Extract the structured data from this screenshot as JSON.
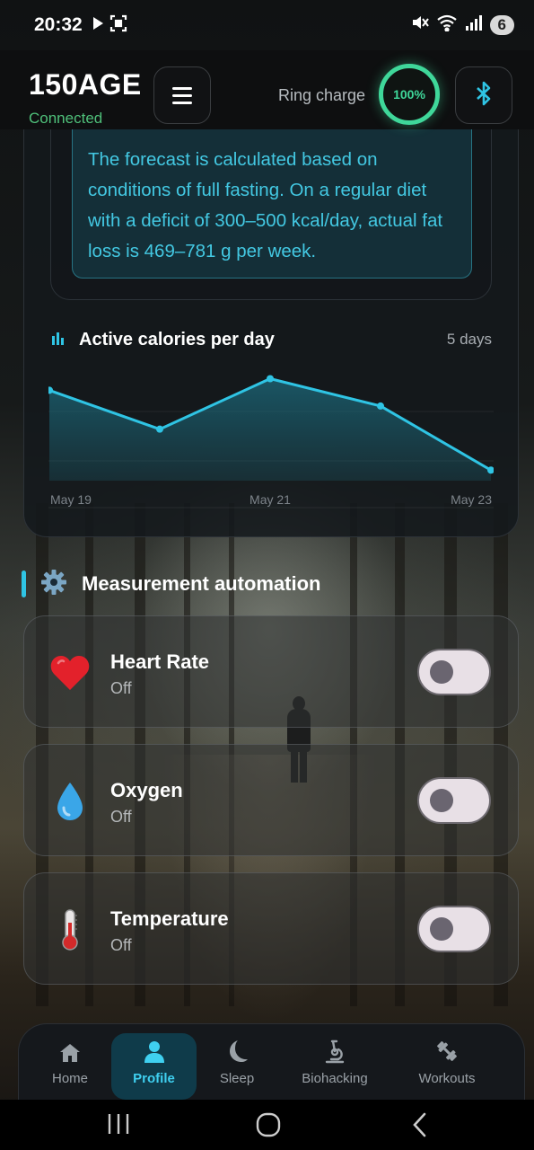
{
  "status_bar": {
    "time": "20:32",
    "notification_count": "6",
    "icons": [
      "play-icon",
      "screenshot-icon",
      "mute-icon",
      "wifi-icon",
      "signal-icon"
    ]
  },
  "header": {
    "app_title": "150AGE",
    "connection_status": "Connected",
    "ring_charge_label": "Ring charge",
    "ring_charge_value": "100%",
    "ring_charge_fraction": 1.0,
    "colors": {
      "connected": "#4fc07a",
      "charge": "#3fd79a",
      "bluetooth": "#2fc4e4"
    }
  },
  "forecast": {
    "text": "The forecast is calculated based on conditions of full fasting. On a regular diet with a deficit of 300–500 kcal/day, actual fat loss is 469–781 g per week."
  },
  "calories_chart": {
    "title": "Active calories per day",
    "range_label": "5 days"
  },
  "chart_data": {
    "type": "area",
    "title": "Active calories per day",
    "x": [
      "May 19",
      "May 20",
      "May 21",
      "May 22",
      "May 23"
    ],
    "tick_labels": [
      "May 19",
      "May 21",
      "May 23"
    ],
    "series": [
      {
        "values": [
          0.86,
          0.49,
          0.97,
          0.71,
          0.1
        ]
      }
    ],
    "ylim": [
      0,
      1
    ],
    "grid": true,
    "line_color": "#2fc4e4",
    "fill_color": "#1c6a7c"
  },
  "automation": {
    "title": "Measurement automation",
    "items": [
      {
        "name": "Heart Rate",
        "status": "Off",
        "icon": "heart-icon",
        "enabled": false
      },
      {
        "name": "Oxygen",
        "status": "Off",
        "icon": "droplet-icon",
        "enabled": false
      },
      {
        "name": "Temperature",
        "status": "Off",
        "icon": "thermometer-icon",
        "enabled": false
      }
    ]
  },
  "bottom_nav": {
    "items": [
      {
        "label": "Home",
        "icon": "home-icon",
        "active": false
      },
      {
        "label": "Profile",
        "icon": "profile-icon",
        "active": true
      },
      {
        "label": "Sleep",
        "icon": "moon-icon",
        "active": false
      },
      {
        "label": "Biohacking",
        "icon": "microscope-icon",
        "active": false
      },
      {
        "label": "Workouts",
        "icon": "dumbbell-icon",
        "active": false
      }
    ]
  }
}
